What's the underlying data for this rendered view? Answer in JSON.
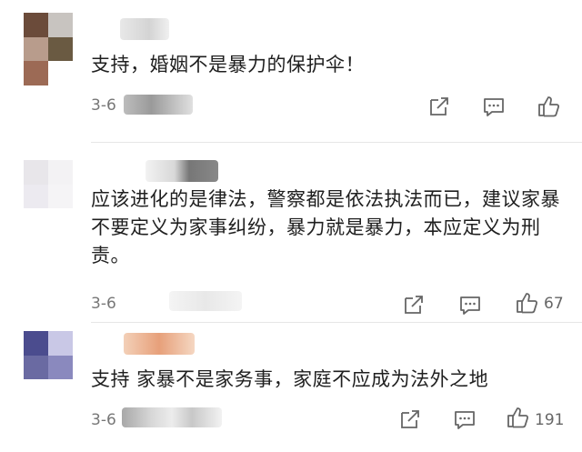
{
  "comments": [
    {
      "text": "支持，婚姻不是暴力的保护伞！",
      "date": "3-6",
      "likes": "",
      "avatar_colors": [
        "#6b4b3a",
        "#c8c4c0",
        "#b89c8c",
        "#6a5a42",
        "#9c6a55",
        "#ffffff"
      ]
    },
    {
      "text": "应该进化的是律法，警察都是依法执法而已，建议家暴不要定义为家事纠纷，暴力就是暴力，本应定义为刑责。",
      "date": "3-6",
      "likes": "67",
      "avatar_colors": [
        "#e8e6ea",
        "#f3f2f4",
        "#eceaf0",
        "#f5f4f6",
        "#ffffff",
        "#ffffff"
      ]
    },
    {
      "text": "支持 家暴不是家务事，家庭不应成为法外之地",
      "date": "3-6",
      "likes": "191",
      "avatar_colors": [
        "#4b4c8e",
        "#c9c8e6",
        "#6a6aa2",
        "#8a89be",
        "#ffffff",
        "#ffffff"
      ]
    }
  ],
  "icons": {
    "share": "share-icon",
    "comment": "comment-icon",
    "like": "thumbs-up-icon"
  },
  "colors": {
    "icon": "#666666",
    "text": "#1f1f1f",
    "meta": "#777777"
  }
}
